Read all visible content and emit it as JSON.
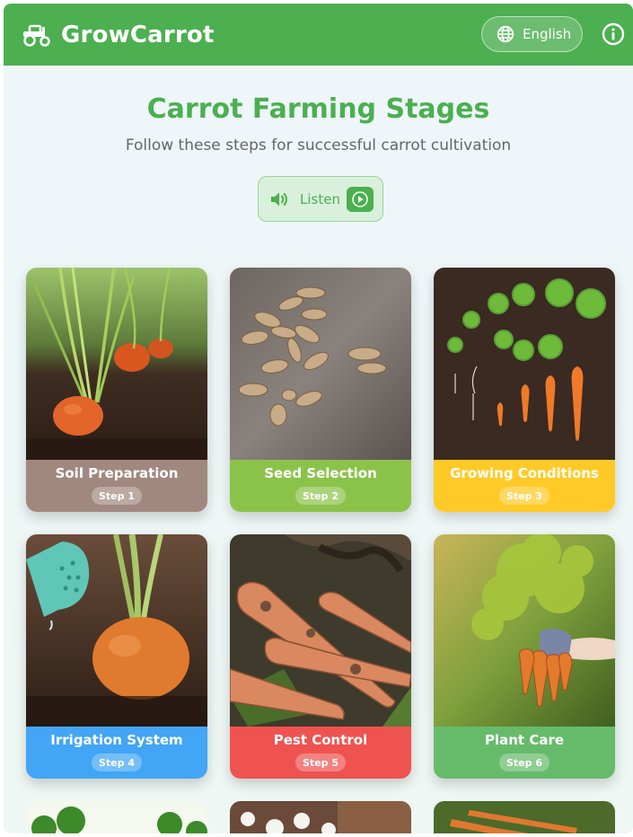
{
  "header": {
    "brand": "GrowCarrot",
    "language_label": "English",
    "logo_icon": "tractor-icon",
    "language_icon": "globe-icon",
    "info_icon": "info-icon",
    "bg_color": "#4caf50"
  },
  "hero": {
    "title": "Carrot Farming Stages",
    "subtitle": "Follow these steps for successful carrot cultivation",
    "listen_label": "Listen",
    "listen_icon": "speaker-icon",
    "play_icon": "play-icon"
  },
  "stages": [
    {
      "title": "Soil Preparation",
      "step": "Step 1",
      "color": "#a1887f"
    },
    {
      "title": "Seed Selection",
      "step": "Step 2",
      "color": "#8bc34a"
    },
    {
      "title": "Growing Conditions",
      "step": "Step 3",
      "color": "#ffca28"
    },
    {
      "title": "Irrigation System",
      "step": "Step 4",
      "color": "#42a5f5"
    },
    {
      "title": "Pest Control",
      "step": "Step 5",
      "color": "#ef5350"
    },
    {
      "title": "Plant Care",
      "step": "Step 6",
      "color": "#66bb6a"
    }
  ]
}
